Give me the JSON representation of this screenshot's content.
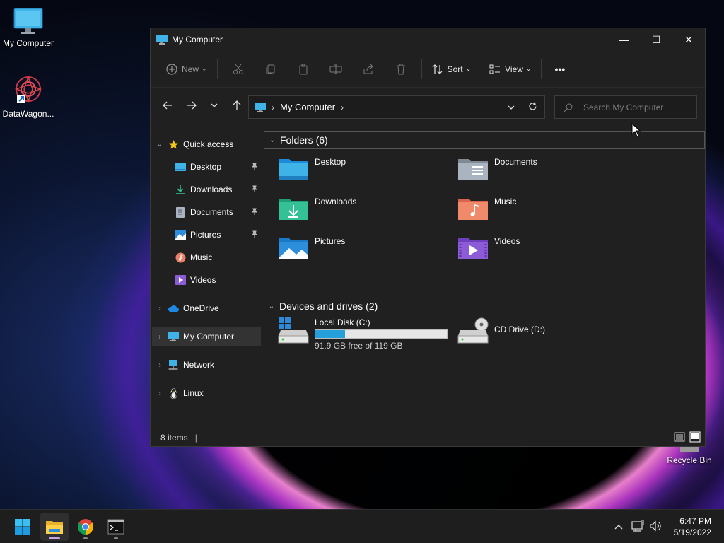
{
  "desktop": {
    "icons": [
      {
        "label": "My Computer",
        "icon": "monitor-icon"
      },
      {
        "label": "DataWagon...",
        "icon": "datawagon-shortcut-icon"
      },
      {
        "label": "Recycle Bin",
        "icon": "recycle-bin-icon"
      }
    ]
  },
  "window": {
    "title": "My Computer",
    "controls": {
      "minimize": "—",
      "maximize": "☐",
      "close": "✕"
    },
    "toolbar": {
      "new_label": "New",
      "sort_label": "Sort",
      "view_label": "View",
      "more_label": "•••"
    },
    "address": {
      "crumb": "My Computer",
      "search_placeholder": "Search My Computer"
    },
    "sidebar": {
      "quick_access": "Quick access",
      "items": [
        {
          "label": "Desktop",
          "pinned": true
        },
        {
          "label": "Downloads",
          "pinned": true
        },
        {
          "label": "Documents",
          "pinned": true
        },
        {
          "label": "Pictures",
          "pinned": true
        },
        {
          "label": "Music",
          "pinned": false
        },
        {
          "label": "Videos",
          "pinned": false
        }
      ],
      "onedrive": "OneDrive",
      "my_computer": "My Computer",
      "network": "Network",
      "linux": "Linux"
    },
    "content": {
      "folders_header": "Folders (6)",
      "folders": [
        "Desktop",
        "Documents",
        "Downloads",
        "Music",
        "Pictures",
        "Videos"
      ],
      "devices_header": "Devices and drives (2)",
      "drives": [
        {
          "name": "Local Disk (C:)",
          "free_text": "91.9 GB free of 119 GB",
          "used_fraction": 0.228
        },
        {
          "name": "CD Drive (D:)"
        }
      ]
    },
    "status": {
      "items": "8 items",
      "cursor": "|"
    }
  },
  "taskbar": {
    "apps": [
      "start-icon",
      "file-explorer-icon",
      "chrome-icon",
      "terminal-icon"
    ],
    "time": "6:47 PM",
    "date": "5/19/2022"
  },
  "colors": {
    "accent": "#26a0da",
    "window_bg": "#202020",
    "taskbar_bg": "#1e1e1e"
  }
}
